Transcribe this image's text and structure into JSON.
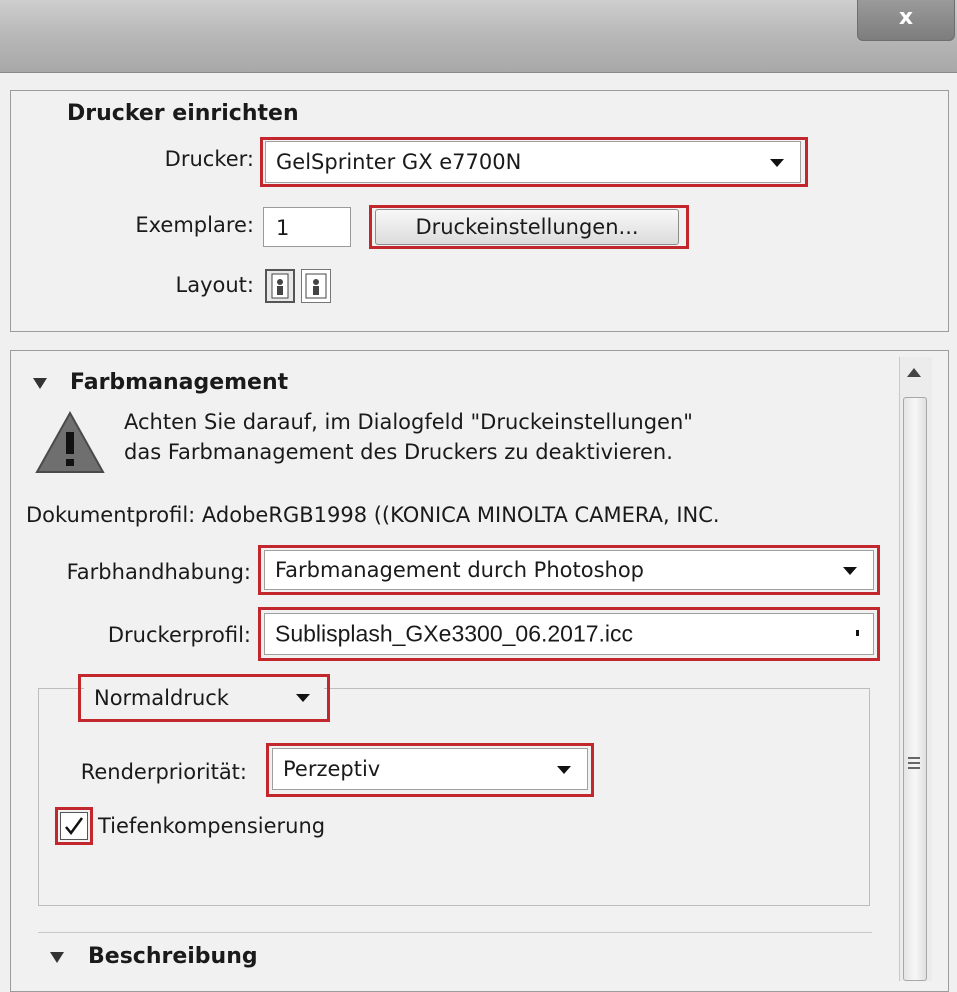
{
  "window": {
    "close_label": "x"
  },
  "printer_setup": {
    "heading": "Drucker einrichten",
    "printer_label": "Drucker:",
    "printer_value": "GelSprinter GX e7700N",
    "copies_label": "Exemplare:",
    "copies_value": "1",
    "print_settings_button": "Druckeinstellungen...",
    "layout_label": "Layout:"
  },
  "color_management": {
    "heading": "Farbmanagement",
    "warning_line1": "Achten Sie darauf, im Dialogfeld \"Druckeinstellungen\"",
    "warning_line2": "das Farbmanagement des Druckers zu deaktivieren.",
    "document_profile": "Dokumentprofil: AdobeRGB1998 ((KONICA MINOLTA CAMERA, INC.",
    "color_handling_label": "Farbhandhabung:",
    "color_handling_value": "Farbmanagement durch Photoshop",
    "printer_profile_label": "Druckerprofil:",
    "printer_profile_value": "Sublisplash_GXe3300_06.2017.icc",
    "print_mode_value": "Normaldruck",
    "rendering_intent_label": "Renderpriorität:",
    "rendering_intent_value": "Perzeptiv",
    "black_point_label": "Tiefenkompensierung",
    "black_point_checked": true
  },
  "description": {
    "heading": "Beschreibung"
  },
  "colors": {
    "highlight": "#c1272d"
  },
  "icons": [
    "close-icon",
    "chevron-down-icon",
    "portrait-layout-icon",
    "landscape-layout-icon",
    "warning-icon",
    "expand-triangle-icon",
    "scroll-up-icon",
    "scroll-grip-icon",
    "checkmark-icon"
  ]
}
